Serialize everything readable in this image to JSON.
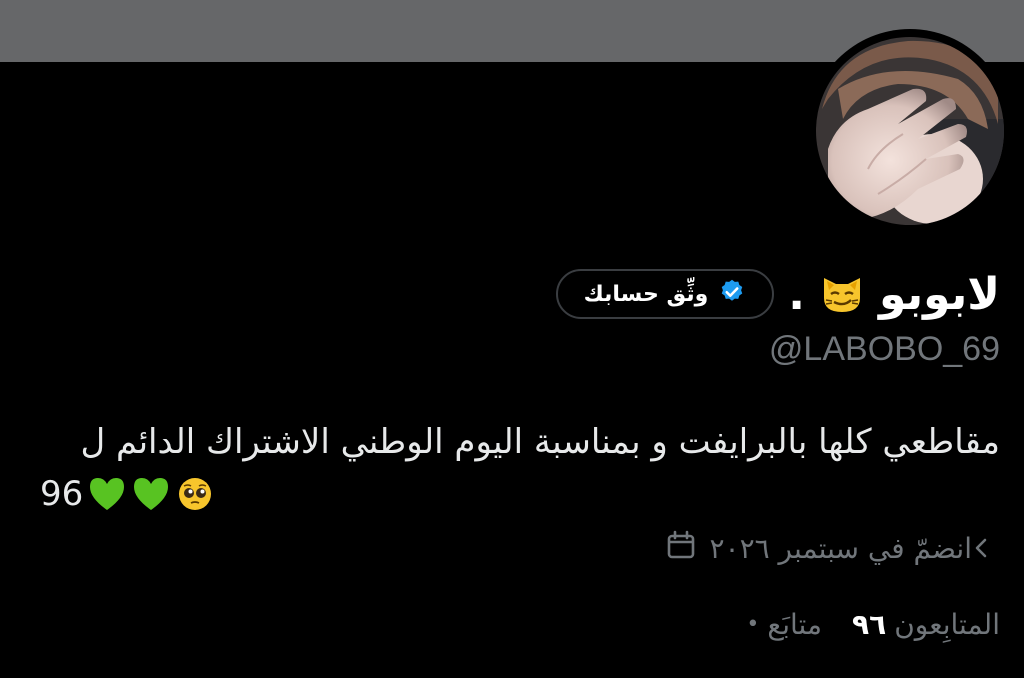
{
  "profile": {
    "display_name": "لابوبو",
    "name_suffix": ".",
    "name_emoji": "smirking-cat-face",
    "verify_label": "وثِّق حسابك",
    "handle": "@LABOBO_69",
    "bio_line1": "مقاطعي كلها بالبرايفت و بمناسبة اليوم الوطني الاشتراك الدائم ل",
    "bio_line2_number": "96",
    "bio_emojis": [
      "green-heart",
      "green-heart",
      "pleading-face"
    ],
    "joined": "انضمّ في سبتمبر ٢٠٢٦",
    "following_label": "متابَع",
    "followers_count": "٩٦",
    "followers_label": "المتابِعون"
  },
  "colors": {
    "banner": "#666769",
    "background": "#000000",
    "muted_text": "#71767b",
    "verified_blue": "#1d9bf0",
    "heart_green": "#58c322"
  }
}
